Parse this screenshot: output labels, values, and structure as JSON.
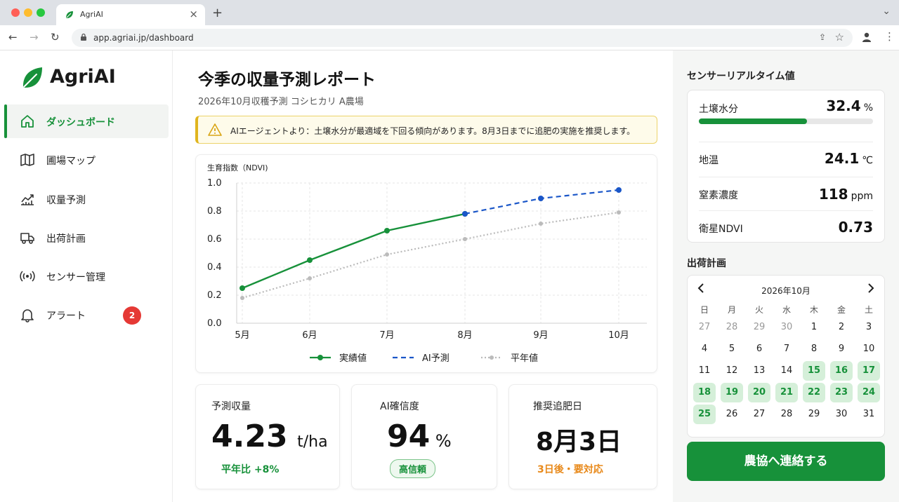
{
  "browser": {
    "tab_title": "AgriAI",
    "tab_close": "×",
    "new_tab": "+",
    "tab_menu": "⌄",
    "url": "app.agriai.jp/dashboard",
    "back": "←",
    "forward": "→",
    "reload": "↻",
    "share": "⇪",
    "star": "☆",
    "menu": "⋮"
  },
  "sidebar": {
    "app_name": "AgriAI",
    "items": [
      {
        "label": "ダッシュボード",
        "icon": "home-icon",
        "active": true
      },
      {
        "label": "圃場マップ",
        "icon": "map-icon"
      },
      {
        "label": "収量予測",
        "icon": "chart-trend-icon"
      },
      {
        "label": "出荷計画",
        "icon": "truck-icon"
      },
      {
        "label": "センサー管理",
        "icon": "sensor-icon"
      },
      {
        "label": "アラート",
        "icon": "bell-icon",
        "badge": "2"
      }
    ]
  },
  "main": {
    "title": "今季の収量予測レポート",
    "subtitle": "2026年10月収穫予測 コシヒカリ A農場",
    "alert": "AIエージェントより：土壌水分が最適域を下回る傾向があります。8月3日までに追肥の実施を推奨します。",
    "stats": [
      {
        "label": "予測収量",
        "value": "4.23",
        "unit": "t/ha",
        "note": "平年比 +8%"
      },
      {
        "label": "AI確信度",
        "value": "94",
        "unit": "%",
        "note": "高信頼"
      },
      {
        "label": "推奨追肥日",
        "value": "8月3日",
        "note": "3日後・要対応"
      }
    ]
  },
  "chart_data": {
    "type": "line",
    "ylabel": "生育指数（NDVI)",
    "categories": [
      "5月",
      "6月",
      "7月",
      "8月",
      "9月",
      "10月"
    ],
    "ylim": [
      0,
      1.0
    ],
    "yticks": [
      "0.0",
      "0.2",
      "0.4",
      "0.6",
      "0.8",
      "1.0"
    ],
    "grid": true,
    "legend_position": "bottom",
    "series": [
      {
        "name": "実績値",
        "values": [
          0.25,
          0.45,
          0.66,
          0.78,
          null,
          null
        ],
        "color": "#17913a",
        "style": "solid"
      },
      {
        "name": "AI予測",
        "values": [
          null,
          null,
          null,
          0.78,
          0.89,
          0.95
        ],
        "color": "#1a56c8",
        "style": "dashed"
      },
      {
        "name": "平年値",
        "values": [
          0.18,
          0.32,
          0.49,
          0.6,
          0.71,
          0.79
        ],
        "color": "#bbbbbb",
        "style": "dotted"
      }
    ]
  },
  "right": {
    "sensor_title": "センサーリアルタイム値",
    "sensors": [
      {
        "label": "土壌水分",
        "value": "32.4",
        "unit": "%",
        "progress": 0.62
      },
      {
        "label": "地温",
        "value": "24.1",
        "unit": "℃"
      },
      {
        "label": "窒素濃度",
        "value": "118",
        "unit": "ppm"
      },
      {
        "label": "衛星NDVI",
        "value": "0.73",
        "unit": ""
      }
    ],
    "calendar_title": "出荷計画",
    "calendar": {
      "month": "2026年10月",
      "prev": "‹",
      "next": "›",
      "weekdays": [
        "日",
        "月",
        "火",
        "水",
        "木",
        "金",
        "土"
      ],
      "weeks": [
        [
          "27",
          "28",
          "29",
          "30",
          "1",
          "2",
          "3"
        ],
        [
          "4",
          "5",
          "6",
          "7",
          "8",
          "9",
          "10"
        ],
        [
          "11",
          "12",
          "13",
          "14",
          "15",
          "16",
          "17"
        ],
        [
          "18",
          "19",
          "20",
          "21",
          "22",
          "23",
          "24"
        ],
        [
          "25",
          "26",
          "27",
          "28",
          "29",
          "30",
          "31"
        ]
      ],
      "muted": [
        "0-0",
        "0-1",
        "0-2",
        "0-3"
      ],
      "highlighted": [
        "2-4",
        "2-5",
        "2-6",
        "3-0",
        "3-1",
        "3-2",
        "3-3",
        "3-4",
        "3-5",
        "3-6",
        "4-0"
      ]
    },
    "contact_button": "農協へ連絡する"
  }
}
